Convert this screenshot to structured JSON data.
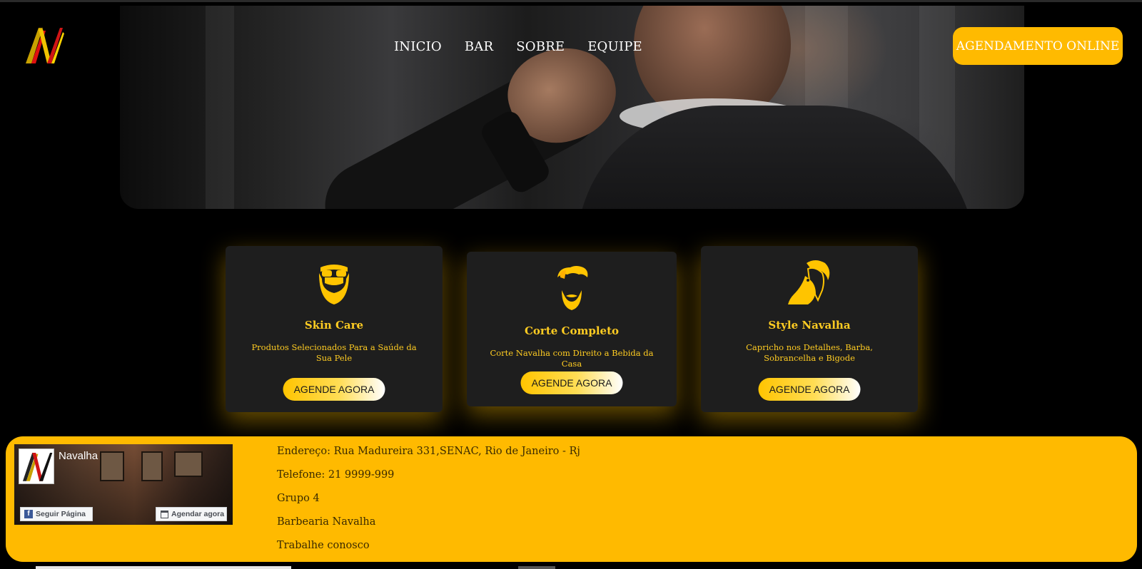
{
  "brand": {
    "logo_icon": "navalha-logo-icon",
    "colors": {
      "accent": "#ffba00",
      "card_bg": "#1e1e1e",
      "page_bg": "#000000"
    }
  },
  "nav": {
    "items": [
      "INICIO",
      "BAR",
      "SOBRE",
      "EQUIPE"
    ]
  },
  "cta": {
    "label": "AGENDAMENTO ONLINE"
  },
  "cards": [
    {
      "icon": "bearded-face-icon",
      "title": "Skin Care",
      "description": "Produtos Selecionados Para a Saúde da Sua Pele",
      "button": "AGENDE AGORA"
    },
    {
      "icon": "hair-beard-icon",
      "title": "Corte Completo",
      "description": "Corte Navalha com Direito a Bebida da Casa",
      "button": "AGENDE AGORA"
    },
    {
      "icon": "styled-man-profile-icon",
      "title": "Style Navalha",
      "description": "Capricho nos Detalhes, Barba, Sobrancelha e Bigode",
      "button": "AGENDE AGORA"
    }
  ],
  "footer": {
    "facebook": {
      "page_name": "Navalha",
      "follow_label": "Seguir Página",
      "book_label": "Agendar agora"
    },
    "info": [
      "Endereço: Rua Madureira 331,SENAC, Rio de Janeiro - Rj",
      "Telefone: 21 9999-999",
      "Grupo 4",
      "Barbearia Navalha",
      "Trabalhe conosco"
    ]
  }
}
